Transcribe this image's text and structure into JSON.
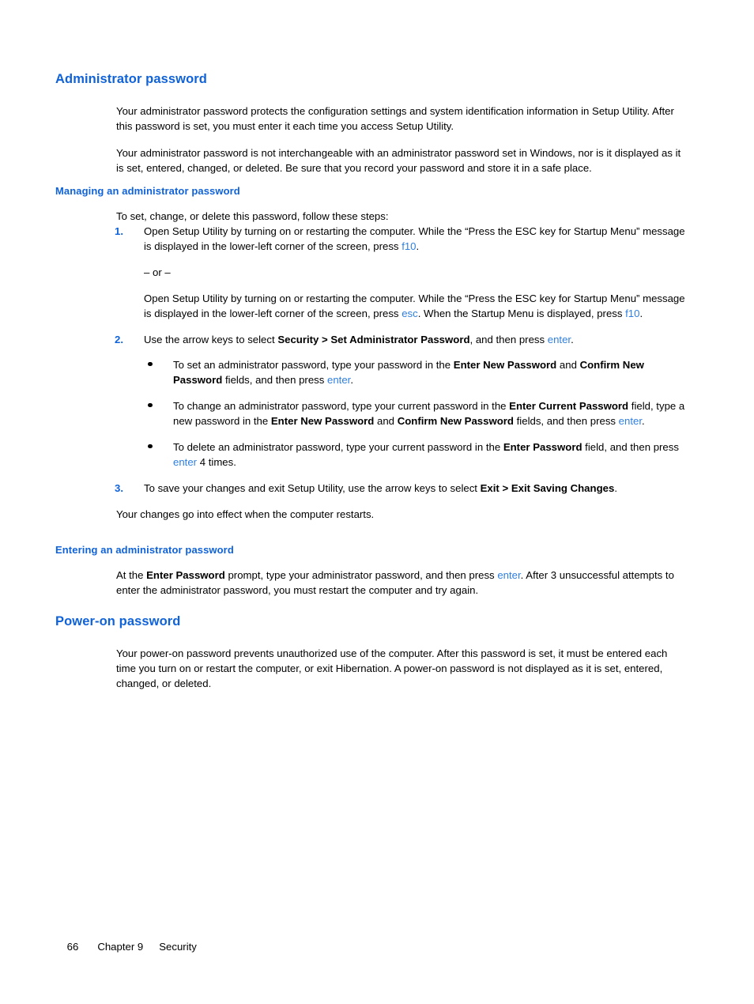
{
  "document": {
    "sections": [
      {
        "heading": "Administrator password",
        "paragraphs": [
          "Your administrator password protects the configuration settings and system identification information in Setup Utility. After this password is set, you must enter it each time you access Setup Utility.",
          "Your administrator password is not interchangeable with an administrator password set in Windows, nor is it displayed as it is set, entered, changed, or deleted. Be sure that you record your password and store it in a safe place."
        ]
      }
    ],
    "managing": {
      "heading": "Managing an administrator password",
      "intro": "To set, change, or delete this password, follow these steps:",
      "steps": [
        {
          "number": "1.",
          "text_before_key": "Open Setup Utility by turning on or restarting the computer. While the “Press the ESC key for Startup Menu” message is displayed in the lower-left corner of the screen, press ",
          "key": "f10",
          "text_after_key": ".",
          "or_divider": "– or –",
          "alt_text_1": "Open Setup Utility by turning on or restarting the computer. While the “Press the ESC key for Startup Menu” message is displayed in the lower-left corner of the screen, press ",
          "alt_key_1": "esc",
          "alt_text_2": ". When the Startup Menu is displayed, press ",
          "alt_key_2": "f10",
          "alt_text_3": "."
        },
        {
          "number": "2.",
          "text_before_bold": "Use the arrow keys to select ",
          "bold": "Security > Set Administrator Password",
          "text_after_bold": ", and then press ",
          "key": "enter",
          "text_end": "."
        },
        {
          "number": "3.",
          "text_before_bold": "To save your changes and exit Setup Utility, use the arrow keys to select ",
          "bold": "Exit > Exit Saving Changes",
          "text_after_bold": "."
        }
      ],
      "bullets": [
        {
          "seg1": "To set an administrator password, type your password in the ",
          "bold1": "Enter New Password",
          "seg2": " and ",
          "bold2": "Confirm New Password",
          "seg3": " fields, and then press ",
          "key": "enter",
          "seg4": "."
        },
        {
          "seg1": "To change an administrator password, type your current password in the ",
          "bold1": "Enter Current Password",
          "seg2": " field, type a new password in the ",
          "bold2": "Enter New Password",
          "seg3": " and ",
          "bold3": "Confirm New Password",
          "seg4": " fields, and then press ",
          "key": "enter",
          "seg5": "."
        },
        {
          "seg1": "To delete an administrator password, type your current password in the ",
          "bold1": "Enter Password",
          "seg2": " field, and then press ",
          "key": "enter",
          "seg3": " 4 times."
        }
      ],
      "closing": "Your changes go into effect when the computer restarts."
    },
    "entering": {
      "heading": "Entering an administrator password",
      "seg1": "At the ",
      "bold1": "Enter Password",
      "seg2": " prompt, type your administrator password, and then press ",
      "key": "enter",
      "seg3": ". After 3 unsuccessful attempts to enter the administrator password, you must restart the computer and try again."
    },
    "poweron": {
      "heading": "Power-on password",
      "paragraph": "Your power-on password prevents unauthorized use of the computer. After this password is set, it must be entered each time you turn on or restart the computer, or exit Hibernation. A power-on password is not displayed as it is set, entered, changed, or deleted."
    },
    "footer": {
      "page_number": "66",
      "chapter": "Chapter 9",
      "chapter_title": "Security"
    },
    "colors": {
      "heading_blue": "#0f62d8",
      "key_blue": "#2f7fe0",
      "body_black": "#000000"
    }
  }
}
